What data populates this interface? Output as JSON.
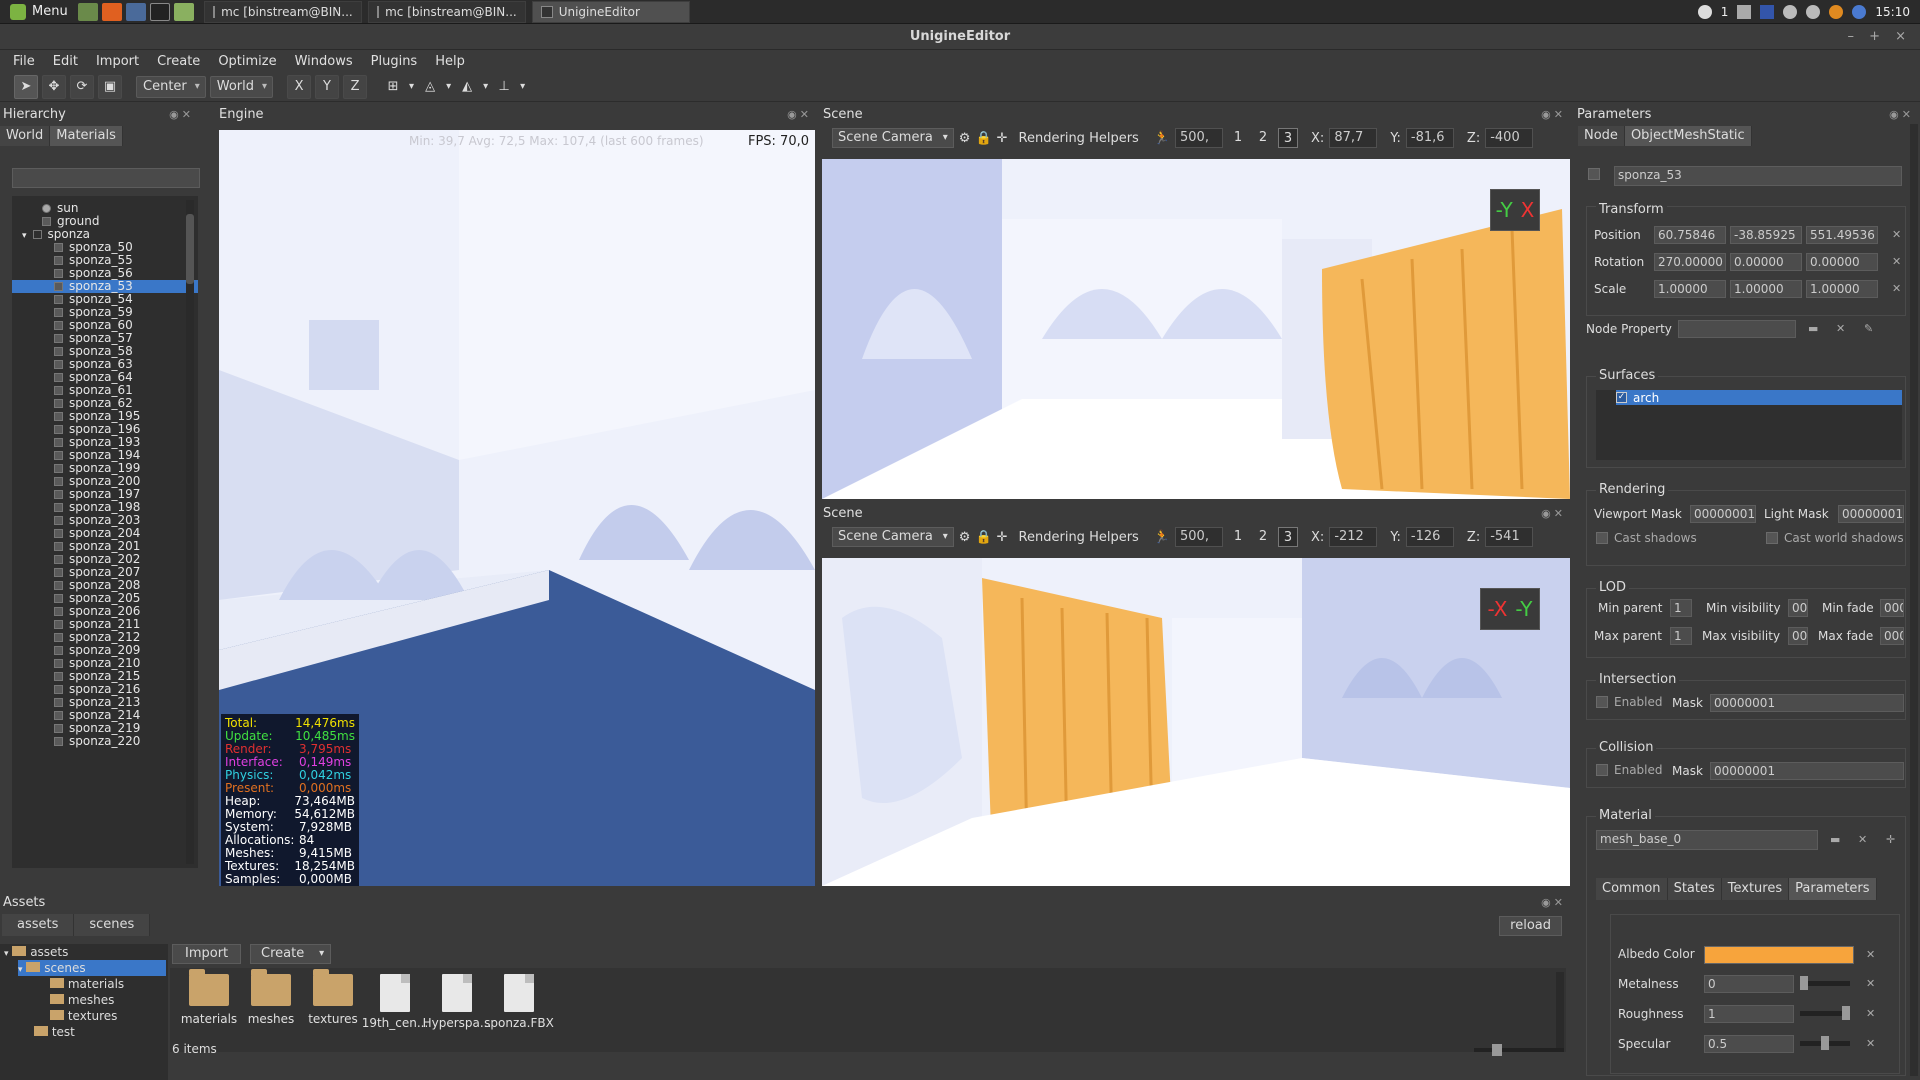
{
  "taskbar": {
    "menu_label": "Menu",
    "tasks": [
      "mc [binstream@BIN...",
      "mc [binstream@BIN...",
      "UnigineEditor"
    ],
    "tray_badge": "1",
    "clock": "15:10"
  },
  "window": {
    "title": "UnigineEditor"
  },
  "menubar": [
    "File",
    "Edit",
    "Import",
    "Create",
    "Optimize",
    "Windows",
    "Plugins",
    "Help"
  ],
  "toolbar": {
    "pivot": "Center",
    "space": "World",
    "axes": [
      "X",
      "Y",
      "Z"
    ]
  },
  "hierarchy": {
    "title": "Hierarchy",
    "tabs": [
      "World",
      "Materials"
    ],
    "search_value": "",
    "root_items": [
      "sun",
      "ground",
      "sponza"
    ],
    "children": [
      "sponza_50",
      "sponza_55",
      "sponza_56",
      "sponza_53",
      "sponza_54",
      "sponza_59",
      "sponza_60",
      "sponza_57",
      "sponza_58",
      "sponza_63",
      "sponza_64",
      "sponza_61",
      "sponza_62",
      "sponza_195",
      "sponza_196",
      "sponza_193",
      "sponza_194",
      "sponza_199",
      "sponza_200",
      "sponza_197",
      "sponza_198",
      "sponza_203",
      "sponza_204",
      "sponza_201",
      "sponza_202",
      "sponza_207",
      "sponza_208",
      "sponza_205",
      "sponza_206",
      "sponza_211",
      "sponza_212",
      "sponza_209",
      "sponza_210",
      "sponza_215",
      "sponza_216",
      "sponza_213",
      "sponza_214",
      "sponza_219",
      "sponza_220"
    ],
    "selected": "sponza_53"
  },
  "engine": {
    "title": "Engine",
    "fps_stats": "Min: 39,7 Avg: 72,5 Max: 107,4 (last 600 frames)",
    "fps": "FPS: 70,0",
    "stats": [
      {
        "k": "Total:",
        "v": "14,476ms",
        "color": "#f0e000"
      },
      {
        "k": "Update:",
        "v": "10,485ms",
        "color": "#40e040"
      },
      {
        "k": "Render:",
        "v": "3,795ms",
        "color": "#e03030"
      },
      {
        "k": "Interface:",
        "v": "0,149ms",
        "color": "#e040e0"
      },
      {
        "k": "Physics:",
        "v": "0,042ms",
        "color": "#30d0e0"
      },
      {
        "k": "Present:",
        "v": "0,000ms",
        "color": "#e07020"
      },
      {
        "k": "Heap:",
        "v": "73,464MB",
        "color": "#ffffff"
      },
      {
        "k": "Memory:",
        "v": "54,612MB",
        "color": "#ffffff"
      },
      {
        "k": "System:",
        "v": "7,928MB",
        "color": "#ffffff"
      },
      {
        "k": "Allocations:",
        "v": "84",
        "color": "#ffffff"
      },
      {
        "k": "Meshes:",
        "v": "9,415MB",
        "color": "#ffffff"
      },
      {
        "k": "Textures:",
        "v": "18,254MB",
        "color": "#ffffff"
      },
      {
        "k": "Samples:",
        "v": "0,000MB",
        "color": "#ffffff"
      }
    ]
  },
  "scene1": {
    "title": "Scene",
    "camera": "Scene Camera",
    "helpers": "Rendering Helpers",
    "speed": "500,",
    "nums": [
      "1",
      "2",
      "3"
    ],
    "x_label": "X:",
    "x": "87,7",
    "y_label": "Y:",
    "y": "-81,6",
    "z_label": "Z:",
    "z": "-400",
    "gizmo": [
      "-Y",
      "X"
    ]
  },
  "scene2": {
    "title": "Scene",
    "camera": "Scene Camera",
    "helpers": "Rendering Helpers",
    "speed": "500,",
    "nums": [
      "1",
      "2",
      "3"
    ],
    "x_label": "X:",
    "x": "-212",
    "y_label": "Y:",
    "y": "-126",
    "z_label": "Z:",
    "z": "-541",
    "gizmo": [
      "-X",
      "-Y"
    ]
  },
  "params": {
    "title": "Parameters",
    "tabs": [
      "Node",
      "ObjectMeshStatic"
    ],
    "name": "sponza_53",
    "transform_title": "Transform",
    "position_label": "Position",
    "position": [
      "60.75846",
      "-38.85925",
      "551.49536"
    ],
    "rotation_label": "Rotation",
    "rotation": [
      "270.00000",
      "0.00000",
      "0.00000"
    ],
    "scale_label": "Scale",
    "scale": [
      "1.00000",
      "1.00000",
      "1.00000"
    ],
    "node_property_label": "Node Property",
    "surfaces_title": "Surfaces",
    "surface": "arch",
    "rendering_title": "Rendering",
    "viewport_mask_label": "Viewport Mask",
    "viewport_mask": "00000001",
    "light_mask_label": "Light Mask",
    "light_mask": "00000001",
    "cast_shadows": "Cast shadows",
    "cast_world_shadows": "Cast world shadows",
    "lod_title": "LOD",
    "min_parent_label": "Min parent",
    "min_parent": "1",
    "min_visibility_label": "Min visibility",
    "min_visibility": "00",
    "min_fade_label": "Min fade",
    "min_fade": "000",
    "max_parent_label": "Max parent",
    "max_parent": "1",
    "max_visibility_label": "Max visibility",
    "max_visibility": "00",
    "max_fade_label": "Max fade",
    "max_fade": "000",
    "intersection_title": "Intersection",
    "enabled_label": "Enabled",
    "mask_label": "Mask",
    "intersection_mask": "00000001",
    "collision_title": "Collision",
    "collision_mask": "00000001",
    "material_title": "Material",
    "material": "mesh_base_0",
    "mat_tabs": [
      "Common",
      "States",
      "Textures",
      "Parameters"
    ],
    "albedo_label": "Albedo Color",
    "albedo_color": "#f7a43c",
    "metalness_label": "Metalness",
    "metalness": "0",
    "roughness_label": "Roughness",
    "roughness": "1",
    "specular_label": "Specular",
    "specular": "0.5"
  },
  "assets": {
    "title": "Assets",
    "tabs": [
      "assets",
      "scenes"
    ],
    "reload": "reload",
    "tree": {
      "root": "assets",
      "selected": "scenes",
      "children": [
        "materials",
        "meshes",
        "textures"
      ],
      "test": "test"
    },
    "import": "Import",
    "create": "Create",
    "items": [
      {
        "name": "materials",
        "kind": "folder"
      },
      {
        "name": "meshes",
        "kind": "folder"
      },
      {
        "name": "textures",
        "kind": "folder"
      },
      {
        "name": "19th_cen...",
        "kind": "file"
      },
      {
        "name": "Hyperspa...",
        "kind": "file"
      },
      {
        "name": "sponza.FBX",
        "kind": "file"
      }
    ],
    "count": "6 items"
  }
}
